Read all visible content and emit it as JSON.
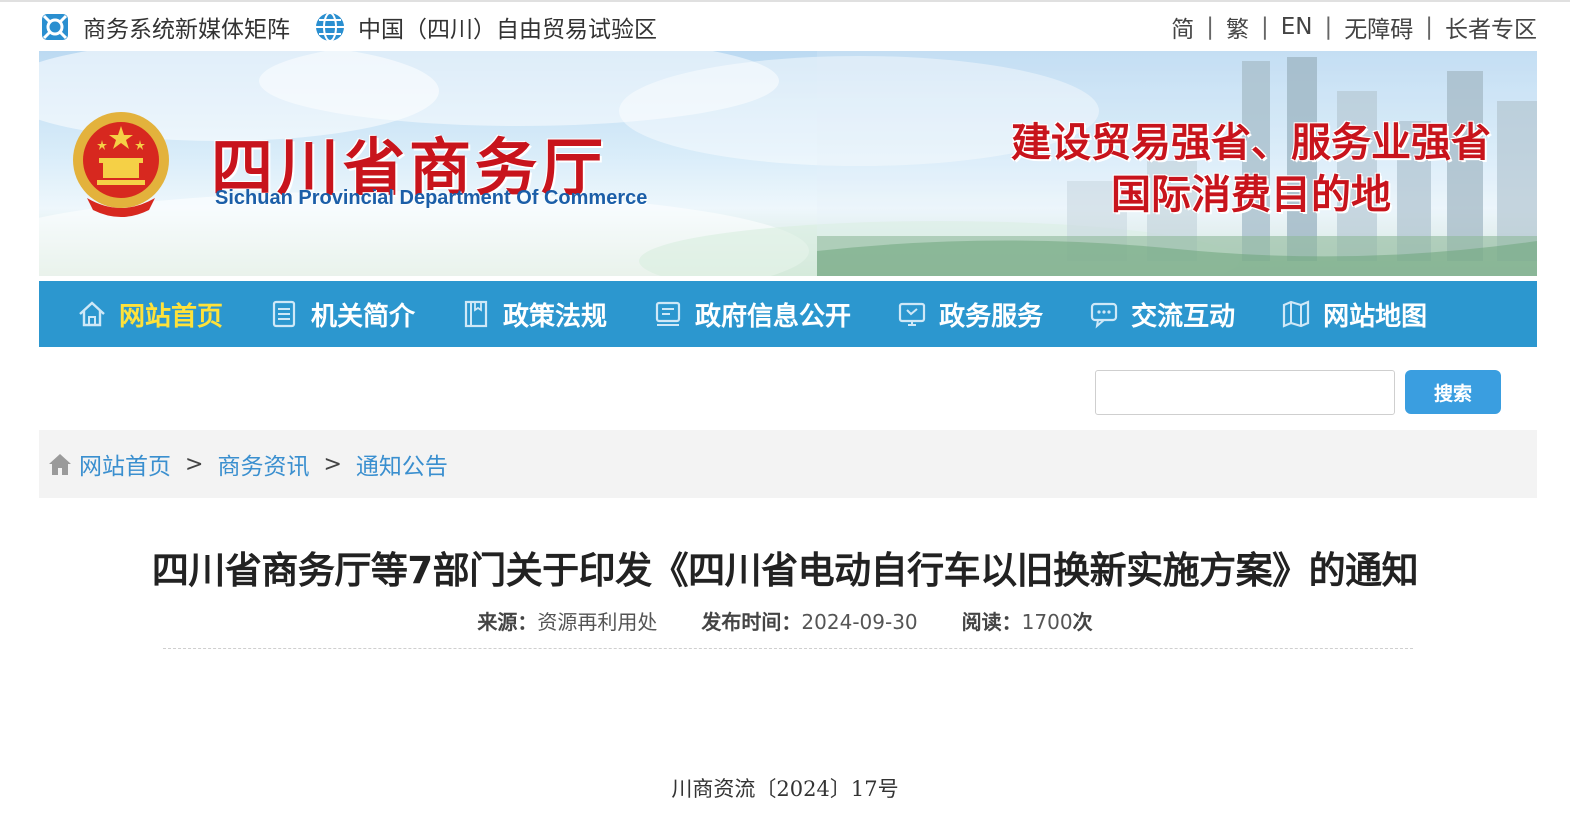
{
  "topbar": {
    "media_matrix": "商务系统新媒体矩阵",
    "free_trade_zone": "中国（四川）自由贸易试验区",
    "lang_simplified": "简",
    "lang_traditional": "繁",
    "lang_en": "EN",
    "accessibility": "无障碍",
    "elderly": "长者专区",
    "sep1": "|",
    "sep2": "|",
    "sep3": "|",
    "sep4": "|"
  },
  "banner": {
    "site_name_cn": "四川省商务厅",
    "site_name_en": "Sichuan Provincial Department Of Commerce",
    "slogan_line1": "建设贸易强省、服务业强省",
    "slogan_line2": "国际消费目的地"
  },
  "nav": {
    "items": [
      {
        "label": "网站首页",
        "icon": "home-icon"
      },
      {
        "label": "机关简介",
        "icon": "document-icon"
      },
      {
        "label": "政策法规",
        "icon": "book-icon"
      },
      {
        "label": "政府信息公开",
        "icon": "info-icon"
      },
      {
        "label": "政务服务",
        "icon": "monitor-icon"
      },
      {
        "label": "交流互动",
        "icon": "chat-icon"
      },
      {
        "label": "网站地图",
        "icon": "map-icon"
      }
    ],
    "active_color": "#ffe23a",
    "background": "#2c97cf"
  },
  "search": {
    "placeholder": "",
    "button_label": "搜索"
  },
  "breadcrumb": {
    "items": [
      "网站首页",
      "商务资讯",
      "通知公告"
    ],
    "separator": ">"
  },
  "article": {
    "title": "四川省商务厅等7部门关于印发《四川省电动自行车以旧换新实施方案》的通知",
    "source_label": "来源：",
    "source_value": "资源再利用处",
    "date_label": "发布时间：",
    "date_value": "2024-09-30",
    "reads_label": "阅读：",
    "reads_value": "1700",
    "reads_unit": "次",
    "doc_number": "川商资流〔2024〕17号"
  }
}
